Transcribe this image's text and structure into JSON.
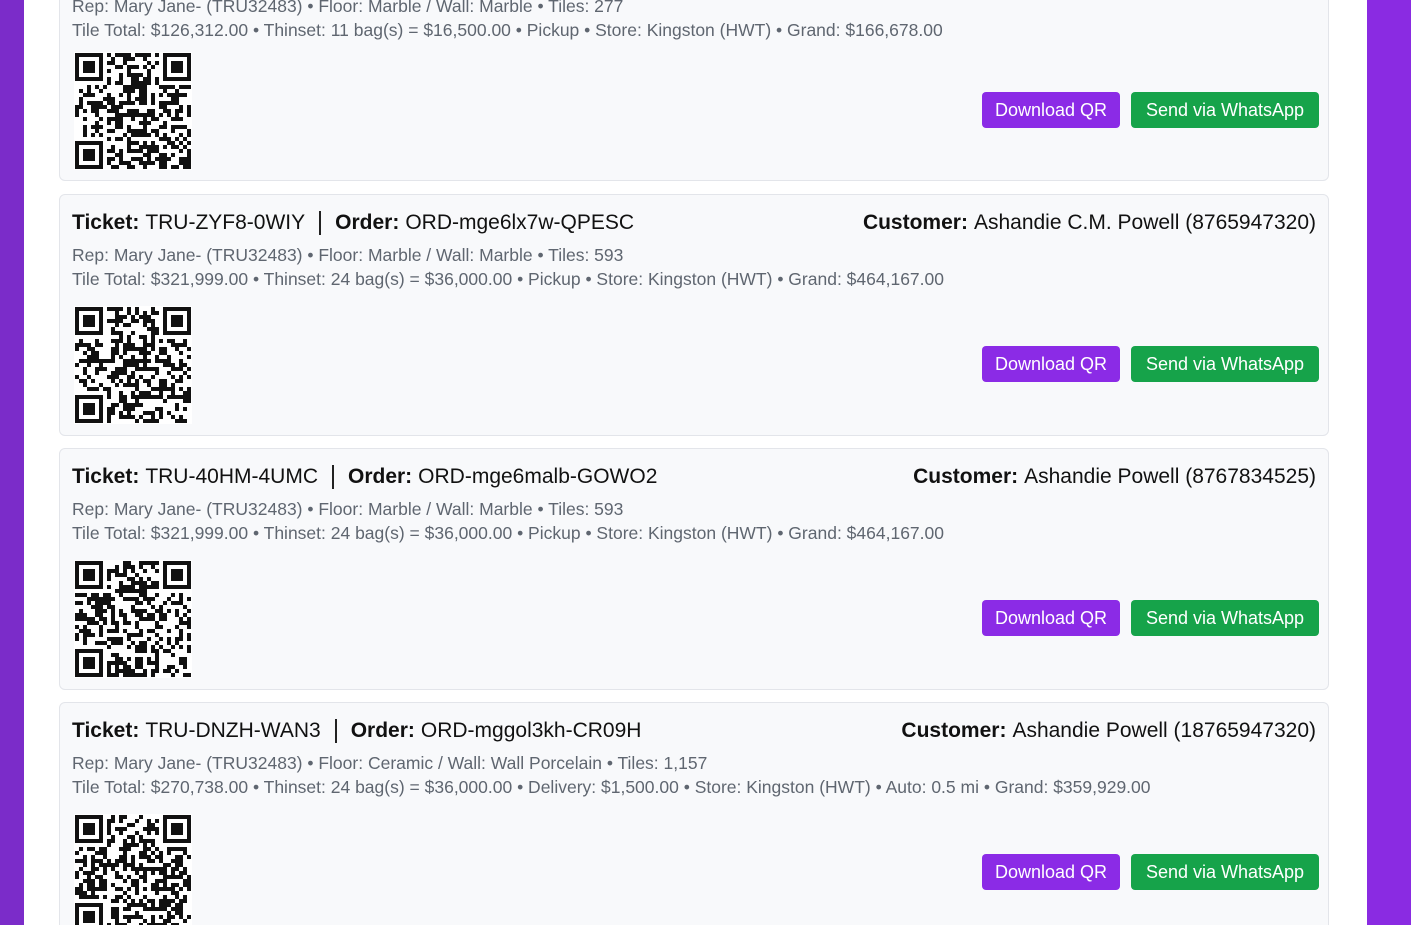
{
  "colors": {
    "accent_purple": "#8b2be6",
    "whatsapp_green": "#16a34a",
    "side_purple": "#7b2cc9"
  },
  "labels": {
    "ticket": "Ticket:",
    "order": "Order:",
    "customer": "Customer:"
  },
  "tickets": [
    {
      "ticket": "",
      "order": "",
      "customer": "",
      "rep_line": "Rep: Mary Jane- (TRU32483) • Floor: Marble / Wall: Marble • Tiles: 277",
      "totals_line": "Tile Total: $126,312.00 • Thinset: 11 bag(s) = $16,500.00 • Pickup • Store: Kingston (HWT) • Grand: $166,678.00",
      "download_label": "Download QR",
      "whatsapp_label": "Send via WhatsApp"
    },
    {
      "ticket": "TRU-ZYF8-0WIY",
      "order": "ORD-mge6lx7w-QPESC",
      "customer": "Ashandie C.M. Powell (8765947320)",
      "rep_line": "Rep: Mary Jane- (TRU32483) • Floor: Marble / Wall: Marble • Tiles: 593",
      "totals_line": "Tile Total: $321,999.00 • Thinset: 24 bag(s) = $36,000.00 • Pickup • Store: Kingston (HWT) • Grand: $464,167.00",
      "download_label": "Download QR",
      "whatsapp_label": "Send via WhatsApp"
    },
    {
      "ticket": "TRU-40HM-4UMC",
      "order": "ORD-mge6malb-GOWO2",
      "customer": "Ashandie Powell (8767834525)",
      "rep_line": "Rep: Mary Jane- (TRU32483) • Floor: Marble / Wall: Marble • Tiles: 593",
      "totals_line": "Tile Total: $321,999.00 • Thinset: 24 bag(s) = $36,000.00 • Pickup • Store: Kingston (HWT) • Grand: $464,167.00",
      "download_label": "Download QR",
      "whatsapp_label": "Send via WhatsApp"
    },
    {
      "ticket": "TRU-DNZH-WAN3",
      "order": "ORD-mggol3kh-CR09H",
      "customer": "Ashandie Powell (18765947320)",
      "rep_line": "Rep: Mary Jane- (TRU32483) • Floor: Ceramic / Wall: Wall Porcelain • Tiles: 1,157",
      "totals_line": "Tile Total: $270,738.00 • Thinset: 24 bag(s) = $36,000.00 • Delivery: $1,500.00 • Store: Kingston (HWT) • Auto: 0.5 mi • Grand: $359,929.00",
      "download_label": "Download QR",
      "whatsapp_label": "Send via WhatsApp"
    }
  ]
}
